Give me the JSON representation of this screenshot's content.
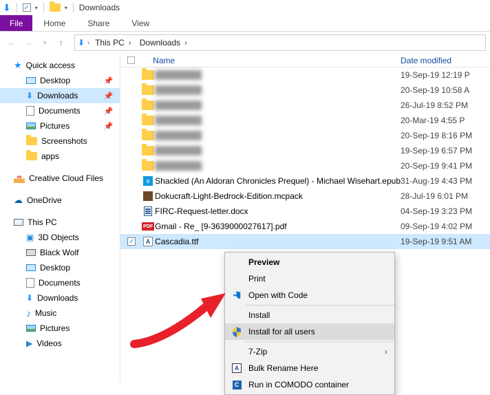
{
  "title": "Downloads",
  "ribbon": {
    "file": "File",
    "home": "Home",
    "share": "Share",
    "view": "View"
  },
  "breadcrumbs": {
    "root": "This PC",
    "folder": "Downloads"
  },
  "columns": {
    "name": "Name",
    "date": "Date modified"
  },
  "tree": {
    "quick_access": "Quick access",
    "desktop": "Desktop",
    "downloads": "Downloads",
    "documents": "Documents",
    "pictures": "Pictures",
    "screenshots": "Screenshots",
    "apps": "apps",
    "ccfiles": "Creative Cloud Files",
    "onedrive": "OneDrive",
    "this_pc": "This PC",
    "threed": "3D Objects",
    "black_wolf": "Black Wolf",
    "desktop2": "Desktop",
    "documents2": "Documents",
    "downloads2": "Downloads",
    "music": "Music",
    "pictures2": "Pictures",
    "videos": "Videos"
  },
  "rows": [
    {
      "name": "",
      "date": "19-Sep-19 12:19 P",
      "type": "folder",
      "blur": true
    },
    {
      "name": "",
      "date": "20-Sep-19 10:58 A",
      "type": "folder",
      "blur": true
    },
    {
      "name": "",
      "date": "26-Jul-19 8:52 PM",
      "type": "folder",
      "blur": true
    },
    {
      "name": "",
      "date": "20-Mar-19 4:55 P",
      "type": "folder",
      "blur": true
    },
    {
      "name": "",
      "date": "20-Sep-19 8:16 PM",
      "type": "folder",
      "blur": true
    },
    {
      "name": "",
      "date": "19-Sep-19 6:57 PM",
      "type": "folder",
      "blur": true
    },
    {
      "name": "",
      "date": "20-Sep-19 9:41 PM",
      "type": "folder",
      "blur": true
    },
    {
      "name": "Shackled (An Aldoran Chronicles Prequel) - Michael Wisehart.epub",
      "date": "31-Aug-19 4:43 PM",
      "type": "epub"
    },
    {
      "name": "Dokucraft-Light-Bedrock-Edition.mcpack",
      "date": "28-Jul-19 6:01 PM",
      "type": "mcpack"
    },
    {
      "name": "FIRC-Request-letter.docx",
      "date": "04-Sep-19 3:23 PM",
      "type": "docx"
    },
    {
      "name": "Gmail - Re_ [9-3639000027617].pdf",
      "date": "09-Sep-19 4:02 PM",
      "type": "pdf"
    },
    {
      "name": "Cascadia.ttf",
      "date": "19-Sep-19 9:51 AM",
      "type": "ttf",
      "selected": true,
      "checked": true
    }
  ],
  "context_menu": {
    "preview": "Preview",
    "print": "Print",
    "open_with_code": "Open with Code",
    "install": "Install",
    "install_all": "Install for all users",
    "sevenzip": "7-Zip",
    "bulk_rename": "Bulk Rename Here",
    "comodo": "Run in COMODO container"
  }
}
